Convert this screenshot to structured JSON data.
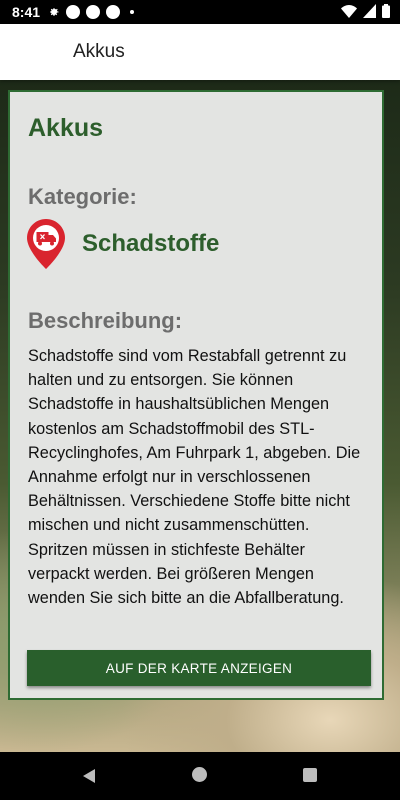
{
  "status_bar": {
    "time": "8:41"
  },
  "app_bar": {
    "title": "Akkus"
  },
  "card": {
    "title": "Akkus",
    "category_label": "Kategorie:",
    "category_name": "Schadstoffe",
    "category_icon": "truck-marker-icon",
    "description_label": "Beschreibung:",
    "description": "Schadstoffe sind vom Restabfall getrennt zu halten und zu entsorgen. Sie können Schadstoffe in haushaltsüblichen Mengen kostenlos am Schadstoffmobil des STL-Recyclinghofes, Am Fuhrpark 1, abgeben. Die Annahme erfolgt nur in verschlossenen Behältnissen. Verschiedene Stoffe bitte nicht mischen und nicht zusammenschütten. Spritzen müssen in stichfeste Behälter verpackt werden. Bei größeren Mengen wenden Sie sich bitte an die Abfallberatung.",
    "map_button_label": "AUF DER KARTE ANZEIGEN"
  },
  "colors": {
    "accent_green": "#2d5e2c",
    "button_green": "#295f2c",
    "marker_red": "#d9242e"
  }
}
